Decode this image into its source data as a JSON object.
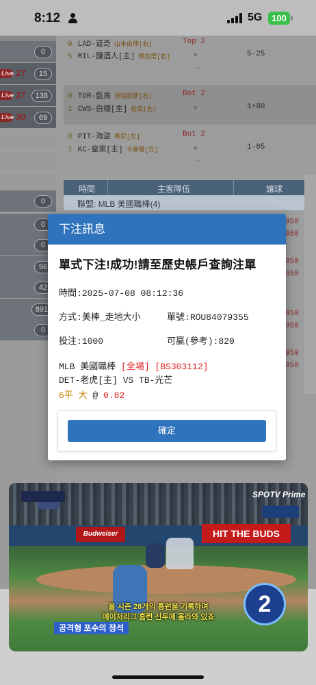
{
  "status": {
    "time": "8:12",
    "network": "5G",
    "battery": "100"
  },
  "sidebar": {
    "rows": [
      {
        "live": "",
        "score": "",
        "count": "0"
      },
      {
        "live": "Live",
        "score": "27",
        "count": "15"
      },
      {
        "live": "Live",
        "score": "27",
        "count": "138"
      },
      {
        "live": "Live",
        "score": "30",
        "count": "69"
      }
    ],
    "rows_lower": [
      "0",
      "0",
      "0",
      "96",
      "42",
      "891",
      "0"
    ]
  },
  "games": [
    {
      "line1_num": "0",
      "line1_team": "LAD-道奇",
      "line1_pitcher": "山本由伸[右]",
      "inning": "Top 2",
      "line2_num": "5",
      "line2_team": "MIL-釀酒人[主]",
      "line2_pitcher": "佩拉塔[右]",
      "line2_right": "5-25"
    },
    {
      "line1_num": "0",
      "line1_team": "TOR-藍鳥",
      "line1_pitcher": "貝瑞歐斯[右]",
      "inning": "Bot 2",
      "line2_num": "1",
      "line2_team": "CWS-白襪[主]",
      "line2_pitcher": "伯克[右]",
      "line2_right": "1+80"
    },
    {
      "line1_num": "0",
      "line1_team": "PIT-海盜",
      "line1_pitcher": "希尼[左]",
      "inning": "Bot 2",
      "line2_num": "1",
      "line2_team": "KC-皇家[主]",
      "line2_pitcher": "卡麥隆[左]",
      "line2_right": "1-85"
    }
  ],
  "table": {
    "col_time": "時間",
    "col_teams": "主客隊伍",
    "col_handicap": "讓球",
    "league": "聯盟: MLB 美國職棒(4)"
  },
  "odds_visible": [
    "950",
    "950",
    "950",
    "950",
    "950",
    "950",
    "950",
    "950"
  ],
  "modal": {
    "title": "下注訊息",
    "success": "單式下注!成功!請至歷史帳戶查詢注單",
    "time_label": "時間:",
    "time_value": "2025-07-08 08:12:36",
    "method_label": "方式:",
    "method_value": "美棒_走地大小",
    "order_label": "單號:",
    "order_value": "ROU84079355",
    "stake_label": "投注:",
    "stake_value": "1000",
    "win_label": "可贏(參考):",
    "win_value": "820",
    "league": "MLB 美國職棒",
    "period": "[全場]",
    "code": "[BS303112]",
    "matchup": "DET-老虎[主] VS TB-光芒",
    "pick_line": "6平 大",
    "at": "@",
    "price": "0.82",
    "confirm": "確定"
  },
  "video": {
    "board_left": "Budweiser",
    "board_right": "HIT THE BUDS",
    "brand": "SPOTV Prime",
    "subtitle_line1": "올 시즌 28개의 홈런을 기록하며",
    "subtitle_line2": "메이저리그 홈런 선두에 올라와 있죠",
    "tag": "공격형 포수의 정석",
    "badge": "2"
  }
}
